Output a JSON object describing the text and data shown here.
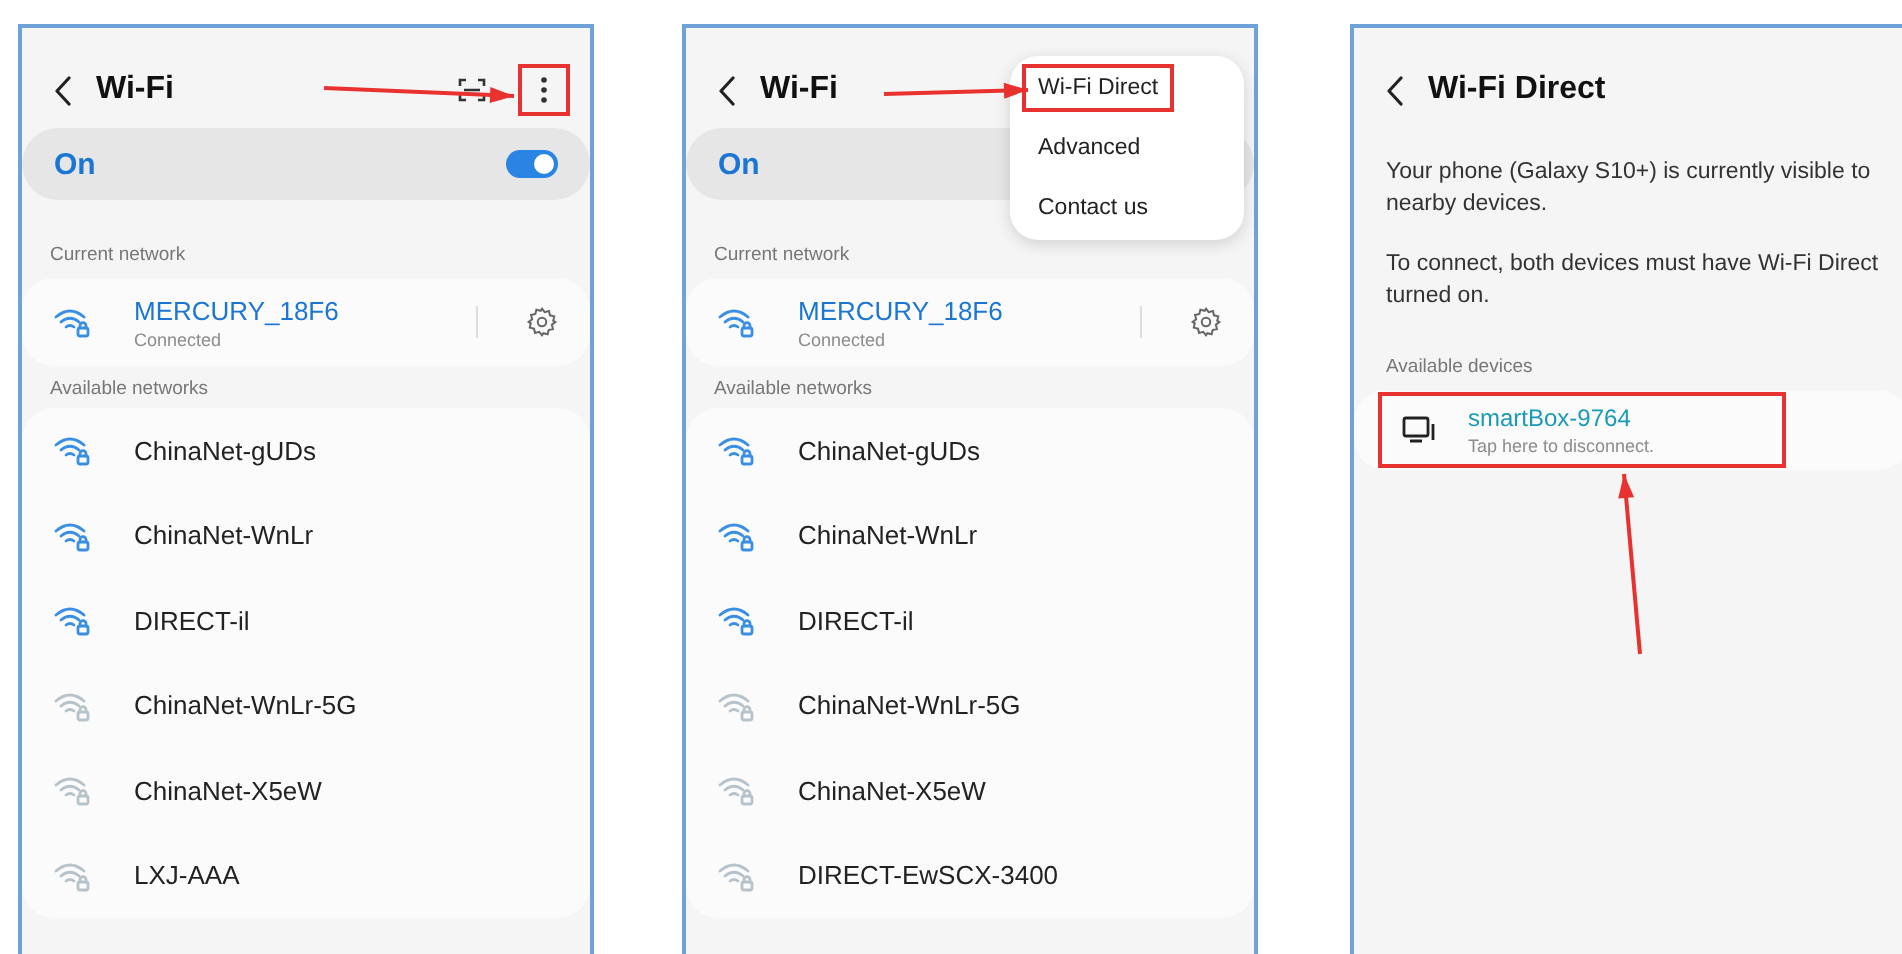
{
  "screens": [
    {
      "kind": "wifi_list",
      "title": "Wi-Fi",
      "more_highlighted": true,
      "arrow": true,
      "switch": {
        "label": "On",
        "on": true
      },
      "current_label": "Current network",
      "current": {
        "name": "MERCURY_18F6",
        "status": "Connected"
      },
      "available_label": "Available networks",
      "networks": [
        {
          "name": "ChinaNet-gUDs",
          "strong": true
        },
        {
          "name": "ChinaNet-WnLr",
          "strong": true
        },
        {
          "name": "DIRECT-il",
          "strong": true
        },
        {
          "name": "ChinaNet-WnLr-5G",
          "strong": false
        },
        {
          "name": "ChinaNet-X5eW",
          "strong": false
        },
        {
          "name": "LXJ-AAA",
          "strong": false
        }
      ]
    },
    {
      "kind": "wifi_list",
      "title": "Wi-Fi",
      "arrow": true,
      "switch": {
        "label": "On"
      },
      "menu": [
        {
          "label": "Wi-Fi Direct",
          "highlighted": true
        },
        {
          "label": "Advanced",
          "highlighted": false
        },
        {
          "label": "Contact us",
          "highlighted": false
        }
      ],
      "current_label": "Current network",
      "current": {
        "name": "MERCURY_18F6",
        "status": "Connected"
      },
      "available_label": "Available networks",
      "networks": [
        {
          "name": "ChinaNet-gUDs",
          "strong": true
        },
        {
          "name": "ChinaNet-WnLr",
          "strong": true
        },
        {
          "name": "DIRECT-il",
          "strong": true
        },
        {
          "name": "ChinaNet-WnLr-5G",
          "strong": false
        },
        {
          "name": "ChinaNet-X5eW",
          "strong": false
        },
        {
          "name": "DIRECT-EwSCX-3400",
          "strong": false
        }
      ]
    },
    {
      "kind": "wifi_direct",
      "title": "Wi-Fi Direct",
      "arrow": true,
      "paragraphs": [
        "Your phone (Galaxy S10+) is currently visible to nearby devices.",
        "To connect, both devices must have Wi-Fi Direct turned on."
      ],
      "devices_label": "Available devices",
      "devices": [
        {
          "name": "smartBox-9764",
          "status": "Tap here to disconnect.",
          "highlighted": true
        }
      ]
    }
  ]
}
